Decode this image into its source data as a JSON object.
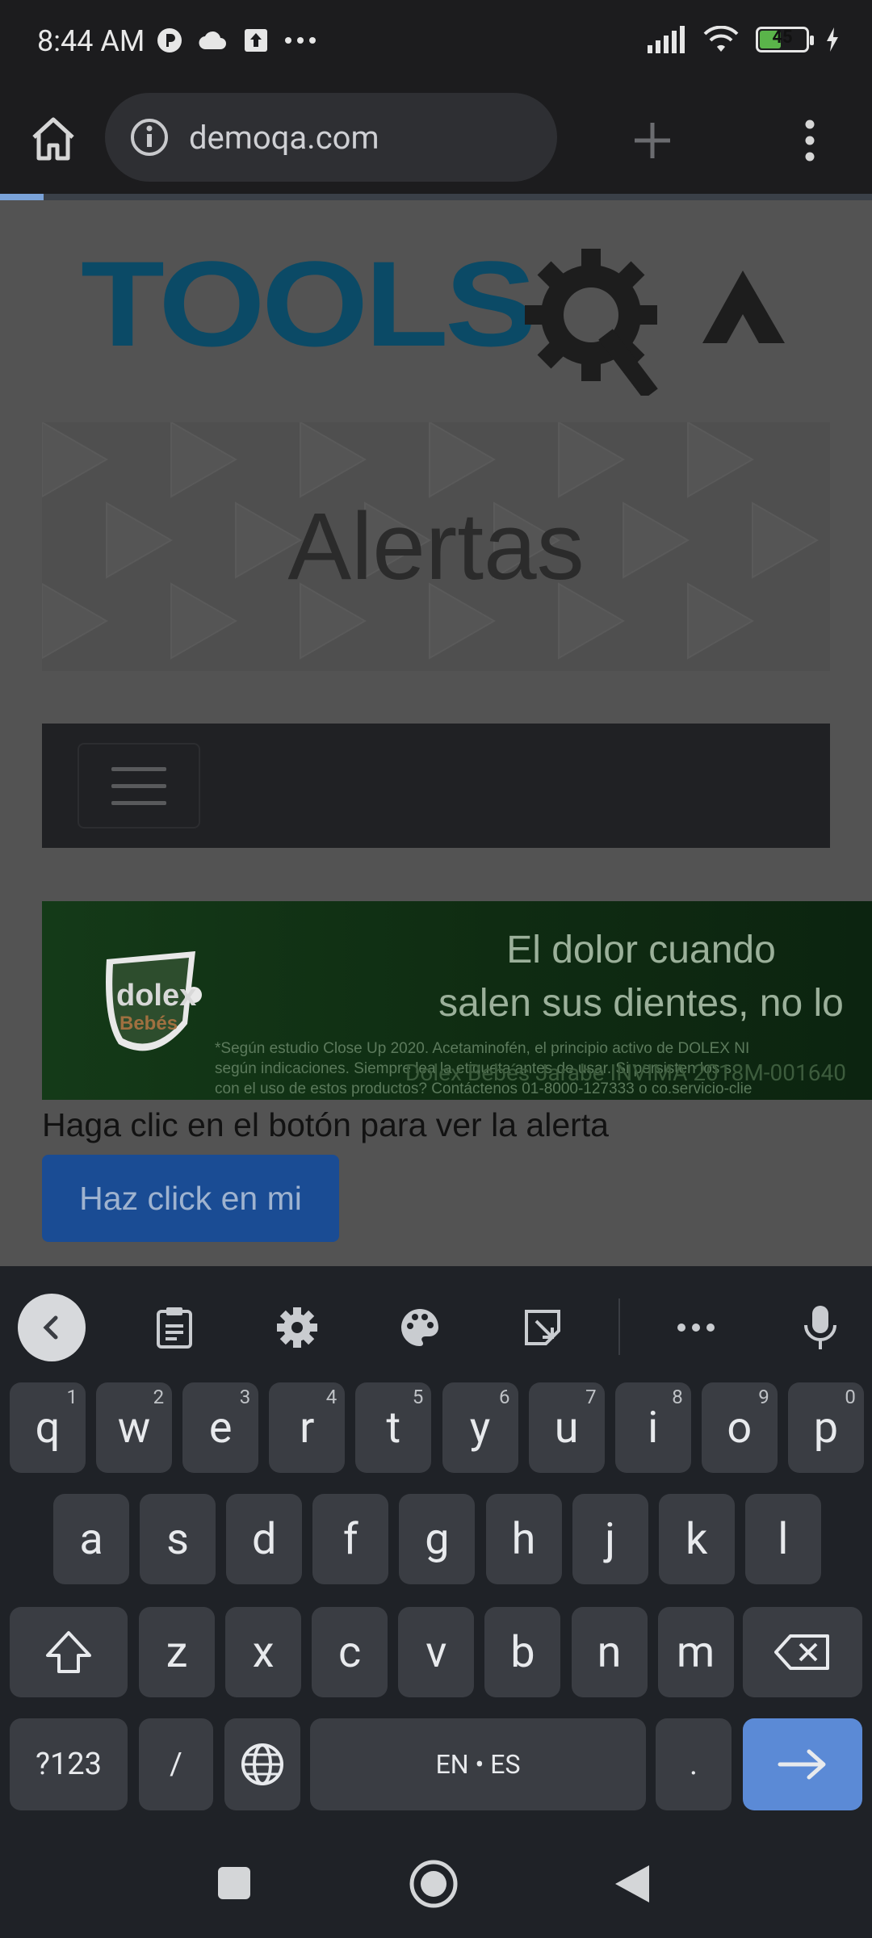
{
  "status_bar": {
    "time": "8:44 AM",
    "battery_level": "45",
    "icons_left": [
      "p-app-icon",
      "cloud-icon",
      "upload-icon",
      "more-dots-icon"
    ],
    "icons_right": [
      "signal-icon",
      "wifi-icon",
      "battery-icon",
      "charging-icon"
    ]
  },
  "browser": {
    "url": "demoqa.com",
    "load_progress": 0.05
  },
  "page": {
    "logo_text": "TOOLSQA",
    "banner_title": "Alertas",
    "ad": {
      "brand": "dolex",
      "sub_brand": "Bebés",
      "headline_line1": "El dolor cuando",
      "headline_line2": "salen sus dientes, no lo",
      "fine_print_1": "*Según estudio Close Up 2020. Acetaminofén, el principio activo de DOLEX NI",
      "fine_print_2": "según indicaciones. Siempre lea la etiqueta antes de usar. Si persisten los s",
      "fine_print_3": "con el uso de estos productos? Contáctenos 01-8000-127333 o co.servicio-clie",
      "fine_print_overlay": "Dolex Bebés Jarabe INVIMA 2018M-001640"
    },
    "prompt_text": "Haga clic en el botón para ver la alerta",
    "alert_button_label": "Haz click en mi"
  },
  "keyboard": {
    "row1": [
      {
        "k": "q",
        "h": "1"
      },
      {
        "k": "w",
        "h": "2"
      },
      {
        "k": "e",
        "h": "3"
      },
      {
        "k": "r",
        "h": "4"
      },
      {
        "k": "t",
        "h": "5"
      },
      {
        "k": "y",
        "h": "6"
      },
      {
        "k": "u",
        "h": "7"
      },
      {
        "k": "i",
        "h": "8"
      },
      {
        "k": "o",
        "h": "9"
      },
      {
        "k": "p",
        "h": "0"
      }
    ],
    "row2": [
      "a",
      "s",
      "d",
      "f",
      "g",
      "h",
      "j",
      "k",
      "l"
    ],
    "row3": [
      "z",
      "x",
      "c",
      "v",
      "b",
      "n",
      "m"
    ],
    "symbols_label": "?123",
    "slash_label": "/",
    "space_label": "EN • ES",
    "period_label": ".",
    "colors": {
      "key": "#3a3d43",
      "action": "#5b8ad6",
      "background": "#1f2227"
    }
  }
}
